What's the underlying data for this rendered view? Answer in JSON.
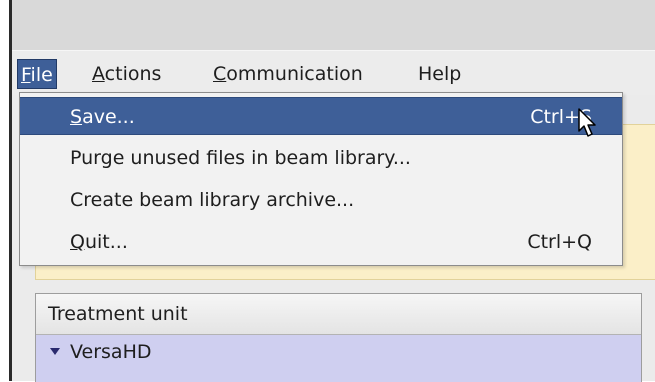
{
  "menubar": {
    "items": [
      {
        "mnemonic": "F",
        "rest": "ile"
      },
      {
        "mnemonic": "A",
        "rest": "ctions"
      },
      {
        "mnemonic": "C",
        "rest": "ommunication"
      },
      {
        "mnemonic": "",
        "rest": "Help"
      }
    ]
  },
  "file_menu": {
    "items": [
      {
        "mnemonic": "S",
        "rest": "ave...",
        "shortcut": "Ctrl+S"
      },
      {
        "mnemonic": "",
        "rest": "Purge unused files in beam library...",
        "shortcut": ""
      },
      {
        "mnemonic": "",
        "rest": "Create beam library archive...",
        "shortcut": ""
      },
      {
        "mnemonic": "Q",
        "rest": "uit...",
        "shortcut": "Ctrl+Q"
      }
    ]
  },
  "table": {
    "header": "Treatment unit",
    "rows": [
      {
        "label": "VersaHD"
      }
    ]
  },
  "icons": {
    "cursor": "mouse-pointer-icon",
    "expand": "triangle-down-icon"
  },
  "colors": {
    "highlight": "#3e5f98",
    "yellow_panel": "#fbefc8",
    "selected_row": "#cfcff0"
  }
}
